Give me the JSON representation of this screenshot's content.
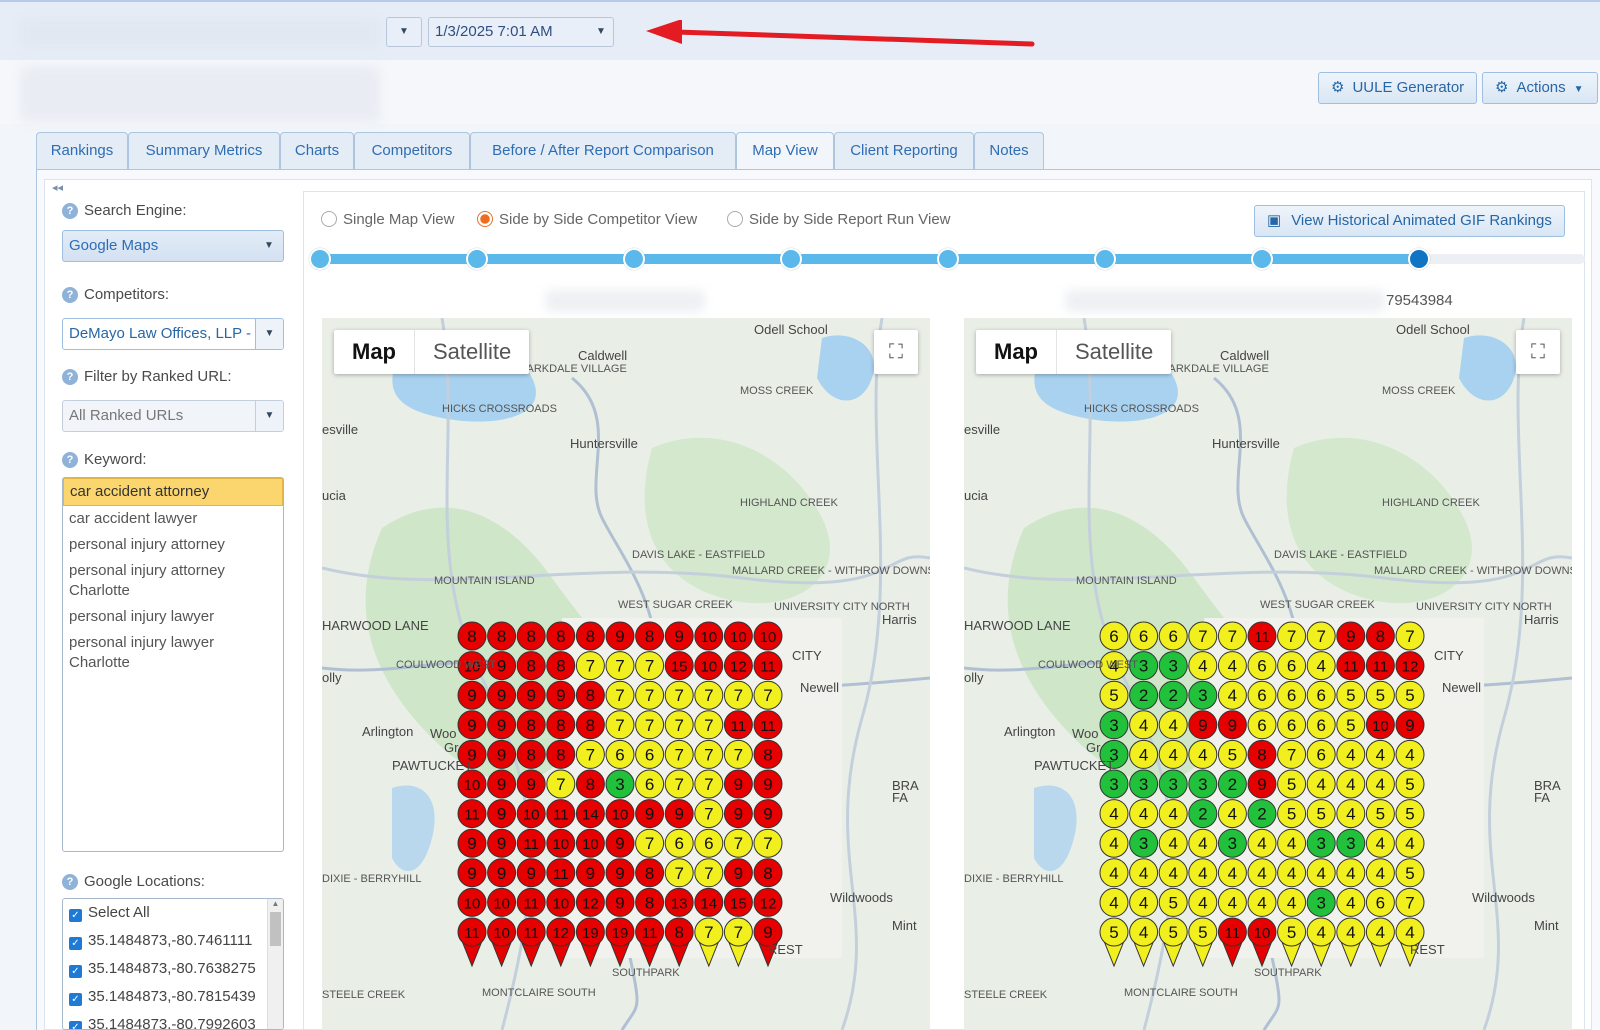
{
  "topbar": {
    "date_value": "1/3/2025 7:01 AM"
  },
  "header_buttons": {
    "uule": "UULE Generator",
    "actions": "Actions"
  },
  "tabs": [
    "Rankings",
    "Summary Metrics",
    "Charts",
    "Competitors",
    "Before / After Report Comparison",
    "Map View",
    "Client Reporting",
    "Notes"
  ],
  "active_tab": "Map View",
  "sidebar": {
    "search_engine_label": "Search Engine:",
    "search_engine_value": "Google Maps",
    "competitors_label": "Competitors:",
    "competitors_value": "DeMayo Law Offices, LLP - ",
    "ranked_url_label": "Filter by Ranked URL:",
    "ranked_url_value": "All Ranked URLs",
    "keyword_label": "Keyword:",
    "keywords": [
      "car accident attorney",
      "car accident lawyer",
      "personal injury attorney",
      "personal injury attorney Charlotte",
      "personal injury lawyer",
      "personal injury lawyer Charlotte"
    ],
    "selected_keyword": "car accident attorney",
    "locations_label": "Google Locations:",
    "locations": [
      "Select All",
      "35.1484873,-80.7461111",
      "35.1484873,-80.7638275",
      "35.1484873,-80.7815439",
      "35.1484873,-80.7992603"
    ]
  },
  "view_options": {
    "single": "Single Map View",
    "side_competitor": "Side by Side Competitor View",
    "side_report": "Side by Side Report Run View",
    "selected": "Side by Side Competitor View",
    "gif_button": "View Historical Animated GIF Rankings"
  },
  "slider": {
    "steps": 8,
    "current": 8
  },
  "map_captions": {
    "left": "",
    "right": "79543984"
  },
  "map_controls": {
    "map": "Map",
    "satellite": "Satellite"
  },
  "map_places": [
    "Odell School",
    "Caldwell",
    "PARKDALE VILLAGE",
    "MOSS CREEK",
    "HICKS CROSSROADS",
    "Huntersville",
    "esville",
    "HIGHLAND CREEK",
    "ucia",
    "DAVIS LAKE - EASTFIELD",
    "MALLARD CREEK - WITHROW DOWNS",
    "MOUNTAIN ISLAND",
    "WEST SUGAR CREEK",
    "UNIVERSITY CITY NORTH",
    "HARWOOD LANE",
    "Harris",
    "COULWOOD WEST",
    "CITY",
    "olly",
    "Newell",
    "Arlington",
    "Woo",
    "Gr",
    "PAWTUCKET",
    "BRA",
    "FA",
    "DIXIE - BERRYHILL",
    "Wildwoods",
    "Mint",
    "SOUTHPARK",
    "REST",
    "STEELE CREEK",
    "MONTCLAIRE SOUTH"
  ],
  "colors": {
    "red": "#e60000",
    "yellow": "#f2ef1f",
    "green": "#22c13c",
    "accent": "#2e6db4"
  },
  "grids": {
    "left": [
      [
        8,
        8,
        8,
        8,
        8,
        9,
        8,
        9,
        10,
        10,
        10
      ],
      [
        10,
        9,
        8,
        8,
        7,
        7,
        7,
        15,
        10,
        12,
        11
      ],
      [
        9,
        9,
        9,
        9,
        8,
        7,
        7,
        7,
        7,
        7,
        7
      ],
      [
        9,
        9,
        8,
        8,
        8,
        7,
        7,
        7,
        7,
        11,
        11
      ],
      [
        9,
        9,
        8,
        8,
        7,
        6,
        6,
        7,
        7,
        7,
        8
      ],
      [
        10,
        9,
        9,
        7,
        8,
        3,
        6,
        7,
        7,
        9,
        9
      ],
      [
        11,
        9,
        10,
        11,
        14,
        10,
        9,
        9,
        7,
        9,
        9
      ],
      [
        9,
        9,
        11,
        10,
        10,
        9,
        7,
        6,
        6,
        7,
        7
      ],
      [
        9,
        9,
        9,
        11,
        9,
        9,
        8,
        7,
        7,
        9,
        8
      ],
      [
        10,
        10,
        11,
        10,
        12,
        9,
        8,
        13,
        14,
        15,
        12
      ],
      [
        11,
        10,
        11,
        12,
        19,
        19,
        11,
        8,
        7,
        7,
        9
      ]
    ],
    "right": [
      [
        6,
        6,
        6,
        7,
        7,
        11,
        7,
        7,
        9,
        8,
        7
      ],
      [
        4,
        3,
        3,
        4,
        4,
        6,
        6,
        4,
        11,
        11,
        12
      ],
      [
        5,
        2,
        2,
        3,
        4,
        6,
        6,
        6,
        5,
        5,
        5
      ],
      [
        3,
        4,
        4,
        9,
        9,
        6,
        6,
        6,
        5,
        10,
        9
      ],
      [
        3,
        4,
        4,
        4,
        5,
        8,
        7,
        6,
        4,
        4,
        4
      ],
      [
        3,
        3,
        3,
        3,
        2,
        9,
        5,
        4,
        4,
        4,
        5
      ],
      [
        4,
        4,
        4,
        2,
        4,
        2,
        5,
        5,
        4,
        5,
        5
      ],
      [
        4,
        3,
        4,
        4,
        3,
        4,
        4,
        3,
        3,
        4,
        4
      ],
      [
        4,
        4,
        4,
        4,
        4,
        4,
        4,
        4,
        4,
        4,
        5
      ],
      [
        4,
        4,
        5,
        4,
        4,
        4,
        4,
        3,
        4,
        6,
        7
      ],
      [
        5,
        4,
        5,
        5,
        11,
        10,
        5,
        4,
        4,
        4,
        4
      ]
    ]
  }
}
